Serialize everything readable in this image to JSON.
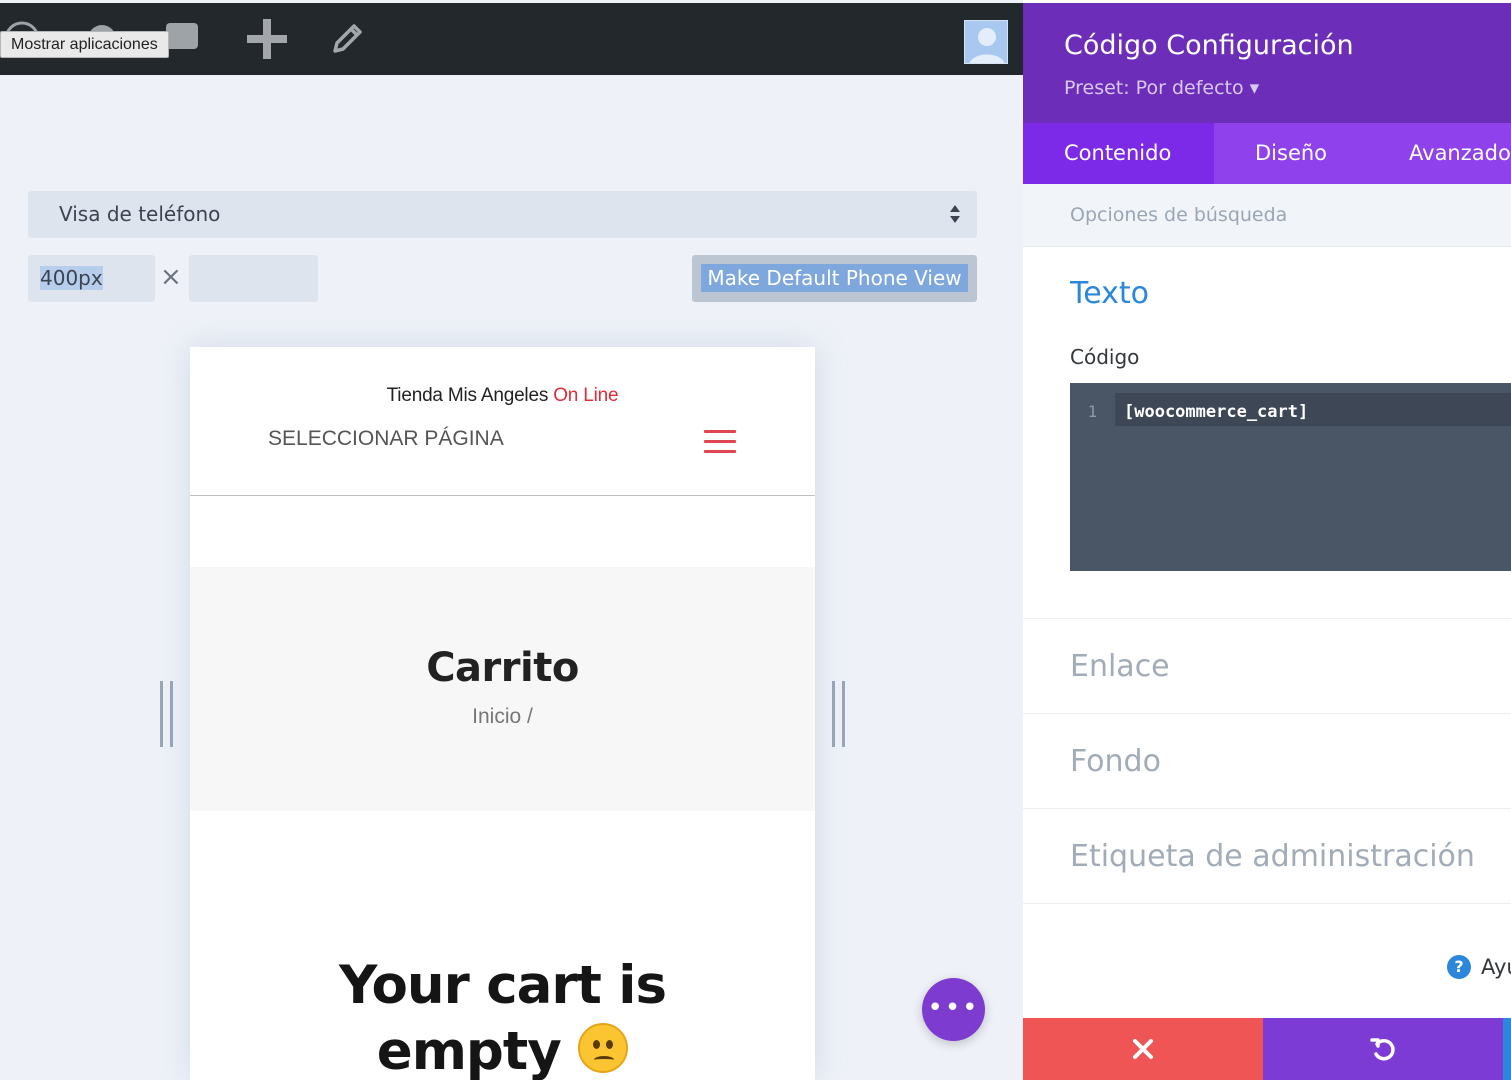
{
  "admin_bar": {
    "tooltip": "Mostrar aplicaciones",
    "icons": [
      "wordpress-icon",
      "customize-icon",
      "comments-icon",
      "add-new-icon",
      "edit-icon",
      "avatar"
    ]
  },
  "responsive_controls": {
    "device_select": "Visa de teléfono",
    "width_value": "400px",
    "times_symbol": "×",
    "height_value": "",
    "make_default_button": "Make Default Phone View"
  },
  "preview": {
    "logo_main": "Tienda Mis Angeles",
    "logo_accent": "On Line",
    "menu_label": "SELECCIONAR PÁGINA",
    "page_title": "Carrito",
    "breadcrumb": "Inicio /",
    "empty_line1": "Your cart is",
    "empty_line2": "empty",
    "fab_label": "•••"
  },
  "settings_panel": {
    "title": "Código Configuración",
    "preset": "Preset: Por defecto ▾",
    "tabs": [
      {
        "label": "Contenido",
        "active": true
      },
      {
        "label": "Diseño",
        "active": false
      },
      {
        "label": "Avanzado",
        "active": false
      }
    ],
    "search_placeholder": "Opciones de búsqueda",
    "section_title": "Texto",
    "code_label": "Código",
    "code_editor": {
      "line_number": "1",
      "code": "[woocommerce_cart]"
    },
    "toggles": [
      "Enlace",
      "Fondo",
      "Etiqueta de administración"
    ],
    "help_label": "Ayu",
    "colors": {
      "header": "#6c2eb9",
      "tabs": "#8f42ec",
      "cancel": "#ef5555",
      "undo": "#7c3bd5",
      "save": "#2b87da"
    }
  }
}
